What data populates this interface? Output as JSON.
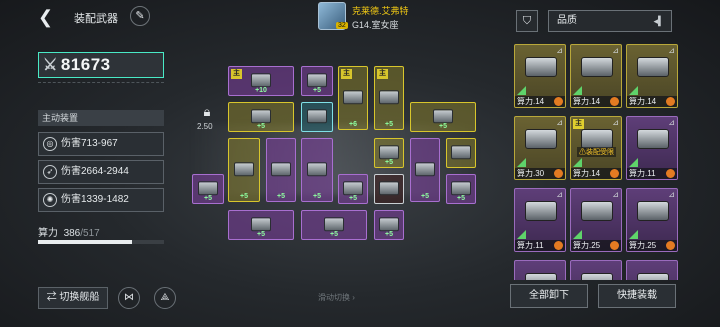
{
  "header": {
    "title": "装配武器",
    "pilot_name": "克莱德.艾弗特",
    "pilot_level": "32",
    "pilot_star": "G14.室女座"
  },
  "left": {
    "power_value": "81673",
    "section_label": "主动装置",
    "damage": [
      {
        "icon": "crosshair-icon",
        "text": "伤害713-967"
      },
      {
        "icon": "missile-icon",
        "text": "伤害2664-2944"
      },
      {
        "icon": "shield-burst-icon",
        "text": "伤害1339-1482"
      }
    ],
    "calc_label": "算力",
    "calc_current": "386",
    "calc_max": "/517",
    "calc_fraction": 0.747
  },
  "grid": {
    "lock_value": "2.50",
    "plus_label": "+5",
    "plus10_label": "+10",
    "plus6_label": "+6",
    "pick_mark": "主"
  },
  "bottom": {
    "switch_ship": "切换舰船",
    "swipe_hint": "滑动切换"
  },
  "right": {
    "filter_label": "品质",
    "cards": [
      {
        "cost": "算力.14",
        "color": "y"
      },
      {
        "cost": "算力.14",
        "color": "y"
      },
      {
        "cost": "算力.14",
        "color": "y"
      },
      {
        "cost": "算力.30",
        "color": "y"
      },
      {
        "cost": "算力.14",
        "color": "y",
        "pick": "主",
        "warn": "装配受限"
      },
      {
        "cost": "算力.11",
        "color": "p"
      },
      {
        "cost": "算力.11",
        "color": "p"
      },
      {
        "cost": "算力.25",
        "color": "p"
      },
      {
        "cost": "算力.25",
        "color": "p"
      }
    ],
    "unload_all": "全部卸下",
    "quick_equip": "快捷装载"
  }
}
